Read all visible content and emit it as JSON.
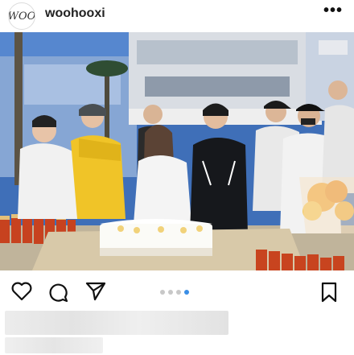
{
  "post": {
    "avatar_text": "WOO",
    "username": "woohooxi",
    "more_label": "•••"
  },
  "carousel": {
    "total": 4,
    "active_index": 3
  },
  "colors": {
    "active_dot": "#3a8ee6",
    "inactive_dot": "#c8c8c8"
  },
  "icons": [
    "heart-icon",
    "comment-icon",
    "share-icon",
    "bookmark-icon"
  ]
}
